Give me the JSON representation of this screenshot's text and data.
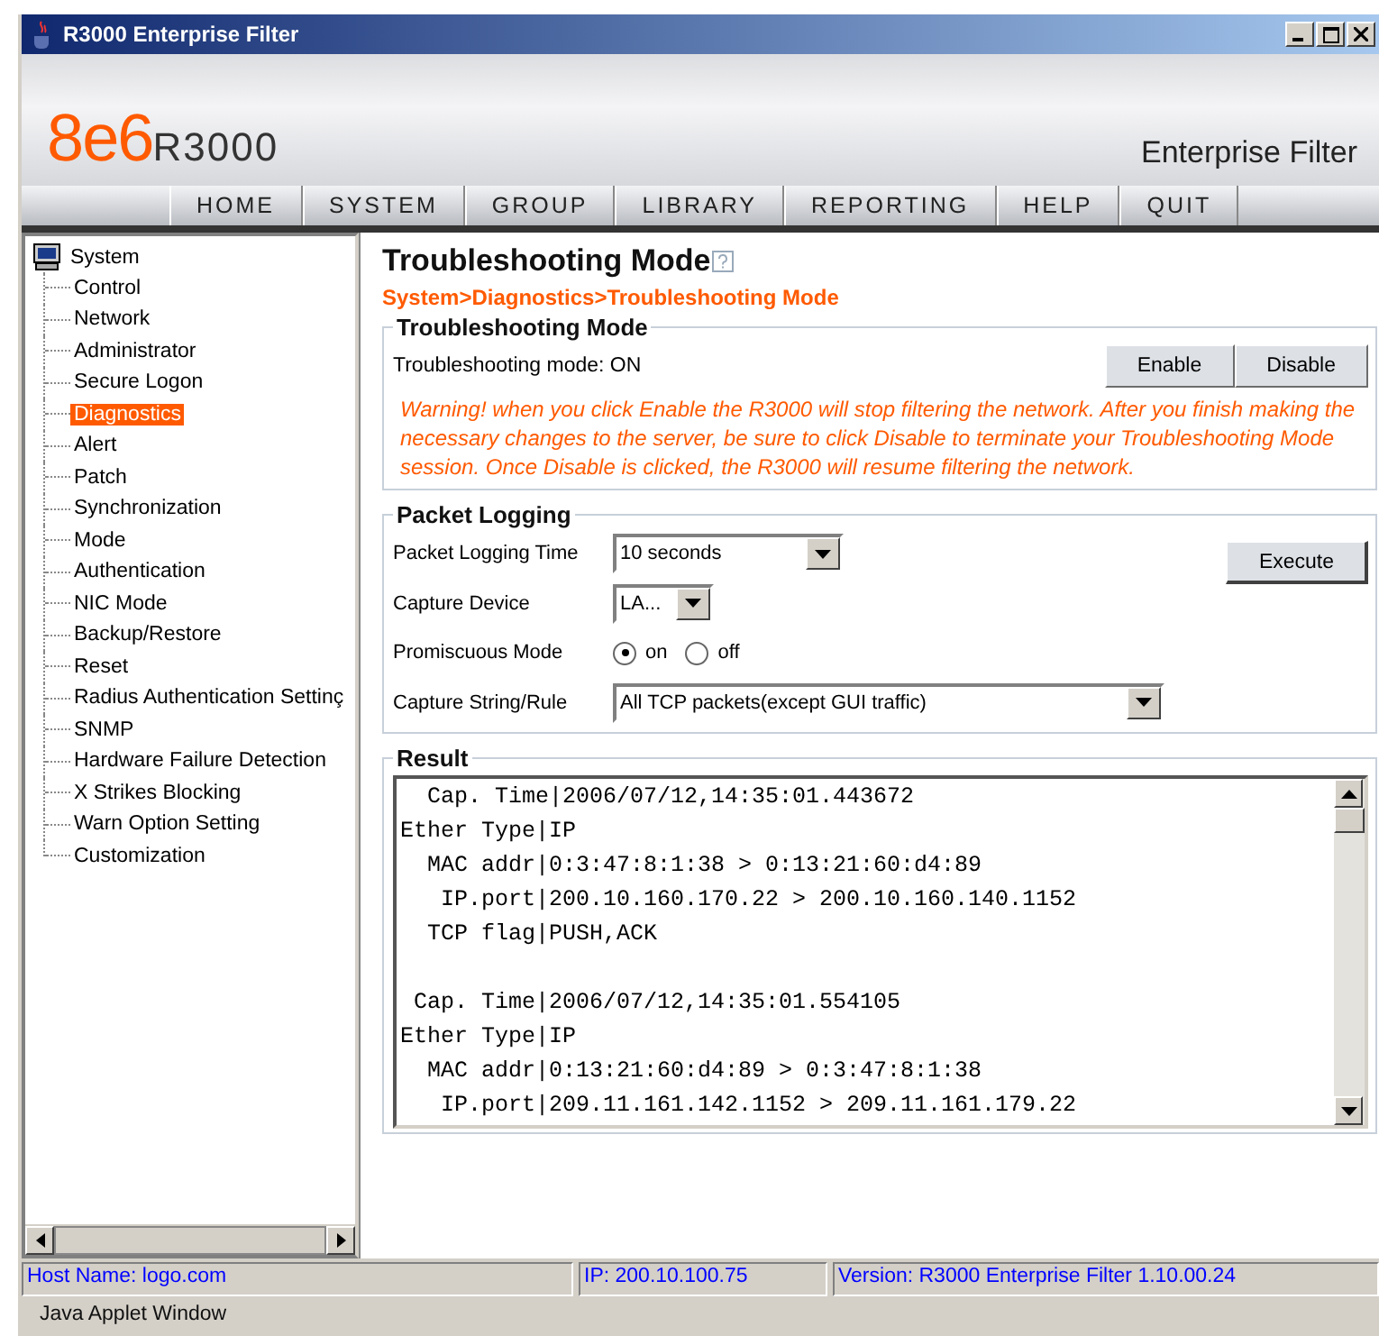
{
  "window": {
    "title": "R3000 Enterprise Filter"
  },
  "header": {
    "logo_brand": "8e6",
    "logo_product": "R3000",
    "product_name": "Enterprise Filter"
  },
  "nav": [
    "HOME",
    "SYSTEM",
    "GROUP",
    "LIBRARY",
    "REPORTING",
    "HELP",
    "QUIT"
  ],
  "sidebar": {
    "root": {
      "label": "System",
      "children": [
        {
          "label": "Control",
          "selected": false
        },
        {
          "label": "Network",
          "selected": false
        },
        {
          "label": "Administrator",
          "selected": false
        },
        {
          "label": "Secure Logon",
          "selected": false
        },
        {
          "label": "Diagnostics",
          "selected": true
        },
        {
          "label": "Alert",
          "selected": false
        },
        {
          "label": "Patch",
          "selected": false
        },
        {
          "label": "Synchronization",
          "selected": false
        },
        {
          "label": "Mode",
          "selected": false
        },
        {
          "label": "Authentication",
          "selected": false
        },
        {
          "label": "NIC Mode",
          "selected": false
        },
        {
          "label": "Backup/Restore",
          "selected": false
        },
        {
          "label": "Reset",
          "selected": false
        },
        {
          "label": "Radius Authentication Settinç",
          "selected": false
        },
        {
          "label": "SNMP",
          "selected": false
        },
        {
          "label": "Hardware Failure Detection",
          "selected": false
        },
        {
          "label": "X Strikes Blocking",
          "selected": false
        },
        {
          "label": "Warn Option Setting",
          "selected": false
        },
        {
          "label": "Customization",
          "selected": false
        }
      ]
    }
  },
  "page": {
    "title": "Troubleshooting Mode",
    "breadcrumb": "System>Diagnostics>Troubleshooting Mode",
    "troubleshooting": {
      "legend": "Troubleshooting Mode",
      "status": "Troubleshooting mode: ON",
      "buttons": [
        "Enable",
        "Disable"
      ],
      "warning": "Warning! when you click Enable the R3000 will stop filtering the network. After you finish making the necessary changes to the server, be sure to click Disable to terminate your Troubleshooting Mode session. Once Disable is clicked, the R3000 will resume filtering the network."
    },
    "packet_logging": {
      "legend": "Packet Logging",
      "execute": "Execute",
      "fields": [
        {
          "kind": "select",
          "label": "Packet Logging Time",
          "value": "10 seconds"
        },
        {
          "kind": "select",
          "label": "Capture Device",
          "value": "LA..."
        },
        {
          "kind": "radio",
          "label": "Promiscuous Mode",
          "options": [
            {
              "label": "on",
              "selected": true
            },
            {
              "label": "off",
              "selected": false
            }
          ]
        },
        {
          "kind": "select",
          "label": "Capture String/Rule",
          "value": "All TCP packets(except GUI traffic)"
        }
      ]
    },
    "result": {
      "legend": "Result",
      "packets": [
        [
          "  Cap. Time|2006/07/12,14:35:01.443672",
          "Ether Type|IP",
          "  MAC addr|0:3:47:8:1:38 > 0:13:21:60:d4:89",
          "   IP.port|200.10.160.170.22 > 200.10.160.140.1152",
          "  TCP flag|PUSH,ACK"
        ],
        [
          " Cap. Time|2006/07/12,14:35:01.554105",
          "Ether Type|IP",
          "  MAC addr|0:13:21:60:d4:89 > 0:3:47:8:1:38",
          "   IP.port|209.11.161.142.1152 > 209.11.161.179.22"
        ]
      ]
    }
  },
  "status_bar": [
    "Host Name: logo.com",
    "IP: 200.10.100.75",
    "Version: R3000 Enterprise Filter 1.10.00.24"
  ],
  "applet_label": "Java Applet Window"
}
